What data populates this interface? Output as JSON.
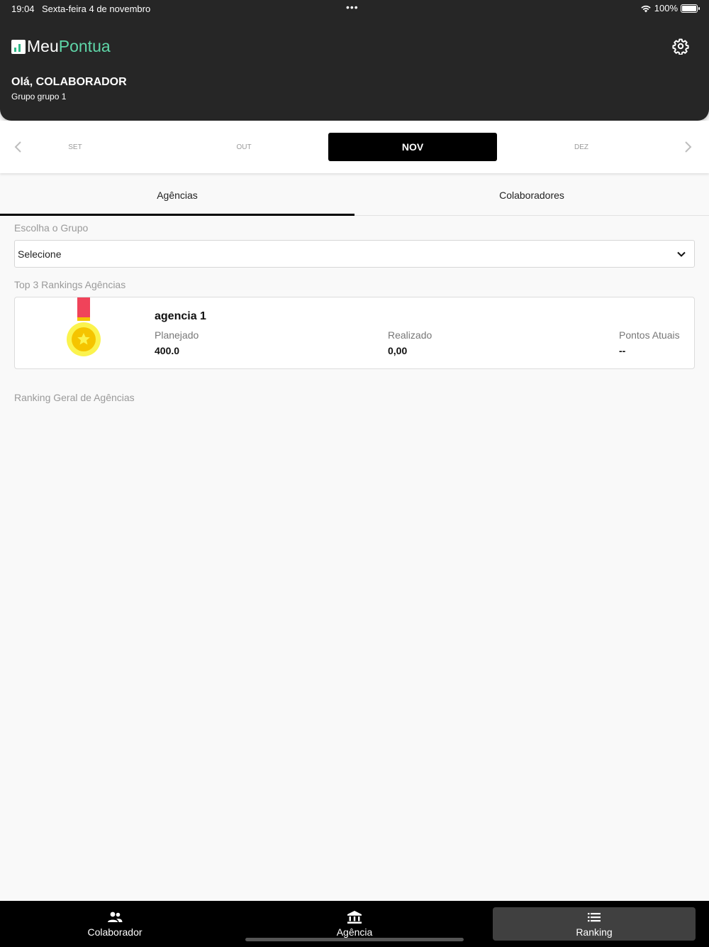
{
  "status_bar": {
    "time": "19:04",
    "date": "Sexta-feira 4 de novembro",
    "dots": "•••",
    "battery": "100%"
  },
  "header": {
    "logo_part1": "Meu",
    "logo_part2": "Pontua",
    "greeting": "Olá, COLABORADOR",
    "group": "Grupo grupo 1"
  },
  "months": {
    "items": [
      "SET",
      "OUT",
      "NOV",
      "DEZ"
    ],
    "selected": "NOV"
  },
  "tabs": {
    "agencias": "Agências",
    "colaboradores": "Colaboradores"
  },
  "group_select": {
    "label": "Escolha o Grupo",
    "value": "Selecione"
  },
  "top3": {
    "label": "Top 3 Rankings Agências",
    "items": [
      {
        "name": "agencia 1",
        "planejado_label": "Planejado",
        "planejado": "400.0",
        "realizado_label": "Realizado",
        "realizado": "0,00",
        "pontos_label": "Pontos Atuais",
        "pontos": "--"
      }
    ]
  },
  "ranking_geral": {
    "label": "Ranking Geral de Agências"
  },
  "bottom_nav": {
    "colaborador": "Colaborador",
    "agencia": "Agência",
    "ranking": "Ranking"
  },
  "colors": {
    "header_bg": "#262626",
    "accent": "#5fd6a8",
    "medal_gold": "#f5d90a",
    "medal_ribbon": "#f0435a"
  },
  "icons": [
    "logo-icon",
    "gear-icon",
    "chevron-left-icon",
    "chevron-right-icon",
    "chevron-down-icon",
    "medal-icon",
    "people-icon",
    "bank-icon",
    "list-icon",
    "wifi-icon",
    "battery-icon"
  ]
}
